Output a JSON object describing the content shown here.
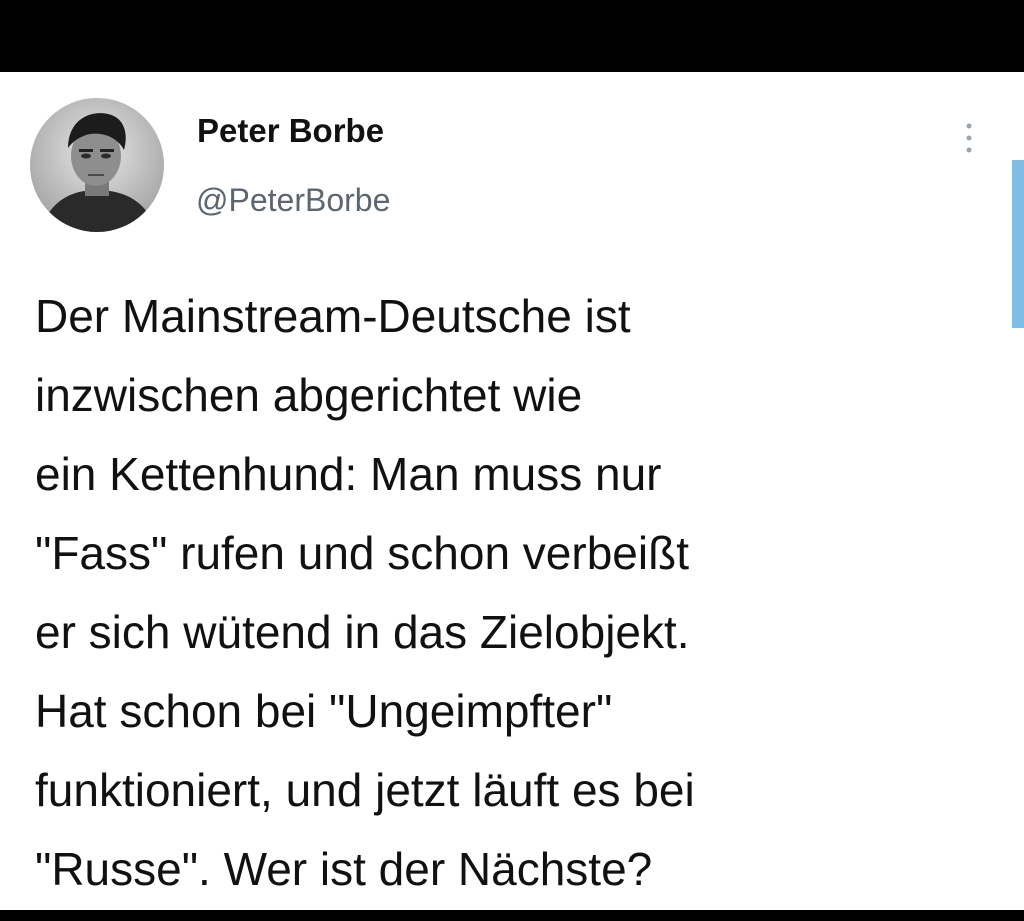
{
  "tweet": {
    "author": {
      "display_name": "Peter Borbe",
      "handle": "@PeterBorbe",
      "avatar_icon": "profile-photo"
    },
    "text_lines": [
      "Der Mainstream-Deutsche ist",
      "inzwischen abgerichtet wie",
      "ein Kettenhund: Man muss nur",
      "\"Fass\" rufen und schon verbeißt",
      "er sich wütend in das Zielobjekt.",
      "Hat schon bei \"Ungeimpfter\"",
      "funktioniert, und jetzt läuft es bei",
      "\"Russe\". Wer ist der Nächste?"
    ],
    "more_icon": "more-vertical-icon"
  },
  "colors": {
    "background": "#ffffff",
    "text": "#111111",
    "secondary_text": "#5b6670",
    "accent": "#7fbde6"
  }
}
